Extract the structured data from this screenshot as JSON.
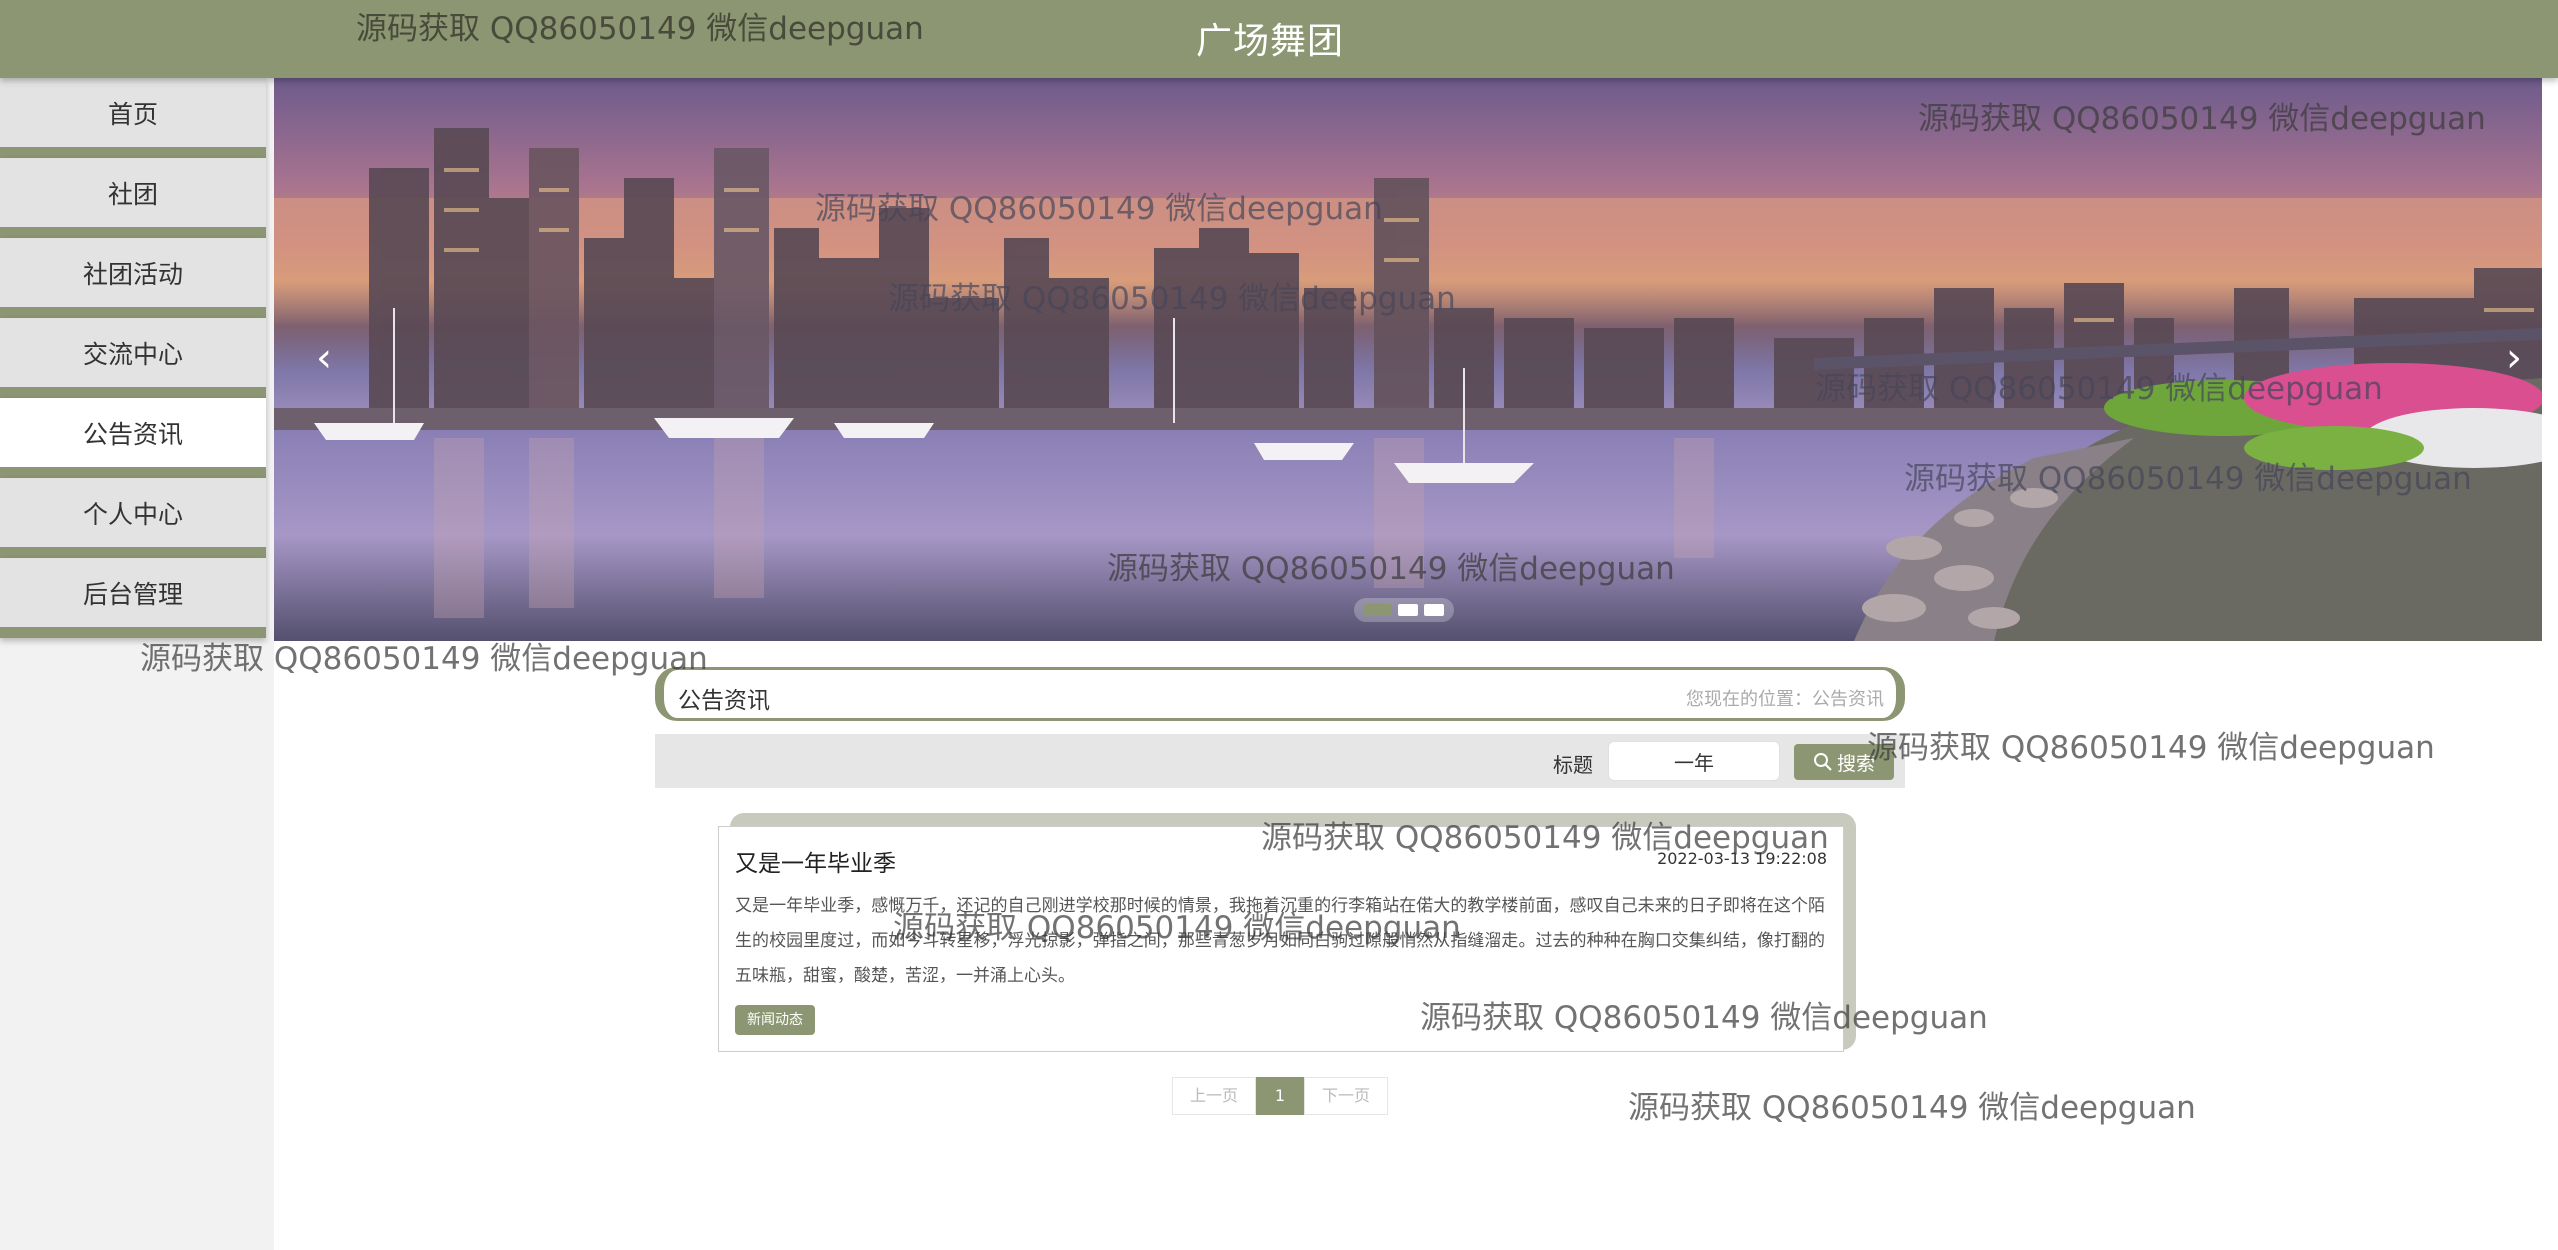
{
  "header": {
    "title": "广场舞团"
  },
  "sidebar": {
    "items": [
      {
        "label": "首页"
      },
      {
        "label": "社团"
      },
      {
        "label": "社团活动"
      },
      {
        "label": "交流中心"
      },
      {
        "label": "公告资讯"
      },
      {
        "label": "个人中心"
      },
      {
        "label": "后台管理"
      }
    ],
    "active_index": 4
  },
  "banner": {
    "prev_symbol": "‹",
    "next_symbol": "›",
    "slide_count": 3,
    "active_slide": 1
  },
  "section": {
    "title": "公告资讯",
    "location": "您现在的位置：公告资讯"
  },
  "search": {
    "label": "标题",
    "value": "一年",
    "button_label": "搜索"
  },
  "news": [
    {
      "title": "又是一年毕业季",
      "date": "2022-03-13 19:22:08",
      "summary": "又是一年毕业季，感慨万千，还记的自己刚进学校那时候的情景，我拖着沉重的行李箱站在偌大的教学楼前面，感叹自己未来的日子即将在这个陌生的校园里度过，而如今斗转星移，浮光掠影，弹指之间，那些青葱岁月如同白驹过隙般悄然从指缝溜走。过去的种种在胸口交集纠结，像打翻的五味瓶，甜蜜，酸楚，苦涩，一并涌上心头。",
      "tag": "新闻动态"
    }
  ],
  "pagination": {
    "prev_label": "上一页",
    "current": "1",
    "next_label": "下一页"
  },
  "watermark": {
    "text": "源码获取 QQ86050149 微信deepguan"
  },
  "colors": {
    "accent": "#8d9673",
    "sidebar_bg": "#e3e3e3",
    "active_bg": "#ffffff"
  }
}
